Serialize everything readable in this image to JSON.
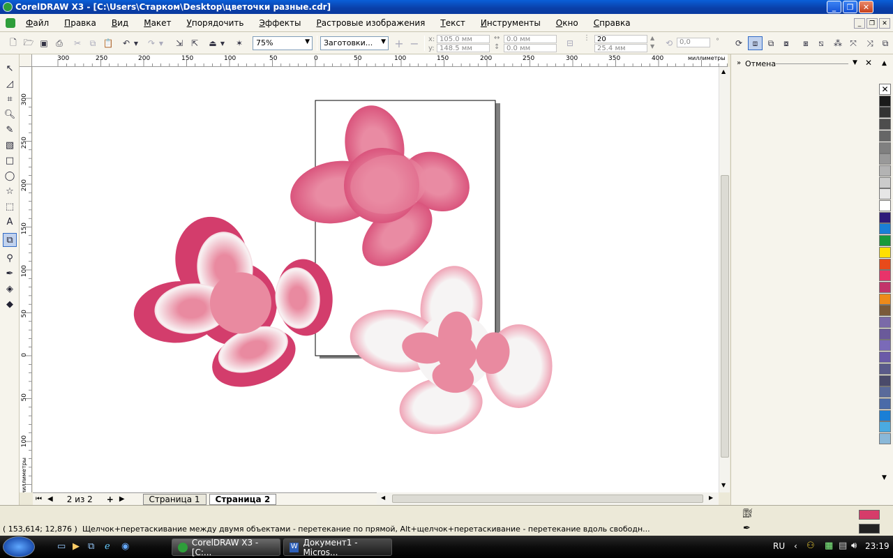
{
  "window": {
    "title": "CorelDRAW X3 - [C:\\Users\\Старком\\Desktop\\цветочки разные.cdr]"
  },
  "menu": [
    "Файл",
    "Правка",
    "Вид",
    "Макет",
    "Упорядочить",
    "Эффекты",
    "Растровые изображения",
    "Текст",
    "Инструменты",
    "Окно",
    "Справка"
  ],
  "toolbar": {
    "zoom": "75%",
    "presets": "Заготовки...",
    "x_label": "x:",
    "x_value": "105.0 мм",
    "y_label": "y:",
    "y_value": "148.5 мм",
    "w_value": "0.0 мм",
    "h_value": "0.0 мм",
    "steps_value": "20",
    "offset_value": "25.4 мм",
    "angle_value": "0,0",
    "angle_unit": "°"
  },
  "ruler": {
    "h_labels": [
      "300",
      "250",
      "200",
      "150",
      "100",
      "50",
      "0",
      "50",
      "100",
      "150",
      "200",
      "250",
      "300",
      "350",
      "400"
    ],
    "unit": "миллиметры",
    "v_labels": [
      "300",
      "250",
      "200",
      "150",
      "100",
      "50",
      "0",
      "50",
      "100"
    ]
  },
  "pages": {
    "counter": "2 из 2",
    "tabs": [
      "Страница 1",
      "Страница 2"
    ],
    "active": "Страница 2"
  },
  "docker": {
    "title": "Отмена"
  },
  "palette": [
    "#ffffff",
    "#1a1a1a",
    "#333333",
    "#4d4d4d",
    "#666666",
    "#808080",
    "#999999",
    "#b3b3b3",
    "#cccccc",
    "#e6e6e6",
    "#ffffff",
    "#2e1a7a",
    "#1a7fd6",
    "#1a9a3a",
    "#ffe000",
    "#e84a1a",
    "#e8336a",
    "#c2346a",
    "#ee8a1a",
    "#7a5a3a",
    "#7a6aa8",
    "#6a5a9a",
    "#7a6ab8",
    "#6a5aa8",
    "#5a5a8a",
    "#4a4a6a",
    "#5a6a9a",
    "#4a6aa8",
    "#1a7fd6",
    "#4aaae0",
    "#8ab8d8"
  ],
  "status": {
    "coords": "( 153,614; 12,876 )",
    "message": "Щелчок+перетаскивание между двумя объектами - перетекание по прямой, Alt+щелчок+перетаскивание - перетекание вдоль свободн...",
    "fill_color": "#d63c6a",
    "outline_color": "#222222"
  },
  "taskbar": {
    "tasks": [
      "CorelDRAW X3 - [C:...",
      "Документ1 - Micros..."
    ],
    "lang": "RU",
    "clock": "23:19"
  }
}
